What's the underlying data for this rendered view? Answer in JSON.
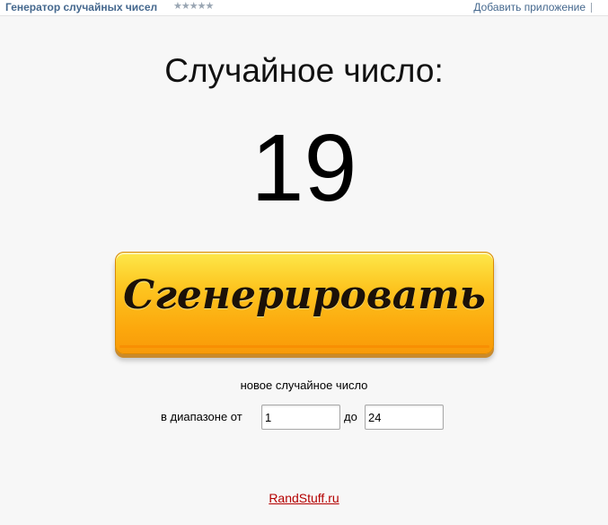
{
  "topbar": {
    "app_title": "Генератор случайных чисел",
    "rating_stars": "★★★★★",
    "add_app_label": "Добавить приложение"
  },
  "main": {
    "heading": "Случайное число:",
    "number": "19",
    "generate_button_label": "Сгенерировать",
    "caption": "новое случайное число",
    "range_from_label": "в диапазоне от",
    "range_from_value": "1",
    "range_to_label": "до",
    "range_to_value": "24"
  },
  "footer": {
    "link_text": "RandStuff.ru"
  },
  "colors": {
    "background": "#f7f7f7",
    "link_blue": "#45688e",
    "button_orange": "#fdc520",
    "footer_red": "#b40000"
  }
}
